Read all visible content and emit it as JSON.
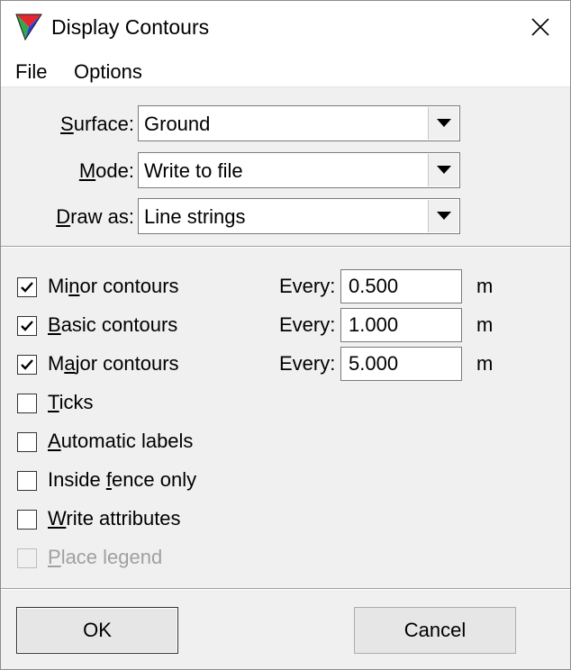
{
  "window": {
    "title": "Display Contours",
    "app_icon": "triangle-app-icon",
    "close_icon": "close-icon"
  },
  "menu": {
    "items": [
      {
        "label": "File"
      },
      {
        "label": "Options"
      }
    ]
  },
  "fields": {
    "surface": {
      "label_mn": "S",
      "label_rest": "urface:",
      "value": "Ground"
    },
    "mode": {
      "label_mn": "M",
      "label_rest": "ode:",
      "value": "Write to file"
    },
    "draw_as": {
      "label_mn": "D",
      "label_rest": "raw as:",
      "value": "Line strings"
    }
  },
  "options": [
    {
      "pre": "Mi",
      "mn": "n",
      "post": "or contours",
      "checked": true,
      "enabled": true
    },
    {
      "pre": "",
      "mn": "B",
      "post": "asic contours",
      "checked": true,
      "enabled": true
    },
    {
      "pre": "M",
      "mn": "a",
      "post": "jor contours",
      "checked": true,
      "enabled": true
    },
    {
      "pre": "",
      "mn": "T",
      "post": "icks",
      "checked": false,
      "enabled": true
    },
    {
      "pre": "",
      "mn": "A",
      "post": "utomatic labels",
      "checked": false,
      "enabled": true
    },
    {
      "pre": "Inside ",
      "mn": "f",
      "post": "ence only",
      "checked": false,
      "enabled": true
    },
    {
      "pre": "",
      "mn": "W",
      "post": "rite attributes",
      "checked": false,
      "enabled": true
    },
    {
      "pre": "",
      "mn": "P",
      "post": "lace legend",
      "checked": false,
      "enabled": false
    }
  ],
  "intervals": {
    "every_label": "Every:",
    "unit": "m",
    "minor": "0.500",
    "basic": "1.000",
    "major": "5.000"
  },
  "buttons": {
    "ok": "OK",
    "cancel": "Cancel"
  },
  "colors": {
    "check": "#000000",
    "disabled_text": "#a0a0a0",
    "icon_red": "#e3262f",
    "icon_green": "#2fa84f",
    "icon_blue": "#2b3ed6"
  }
}
